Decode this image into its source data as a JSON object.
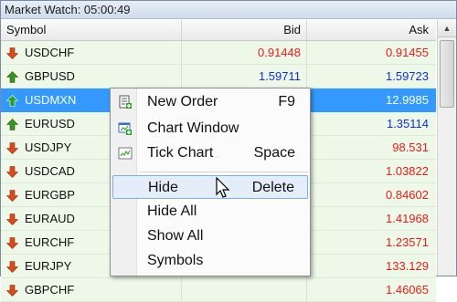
{
  "window": {
    "title": "Market Watch: 05:00:49"
  },
  "columns": {
    "symbol": "Symbol",
    "bid": "Bid",
    "ask": "Ask"
  },
  "colors": {
    "up": "#22a022",
    "down": "#e04a1a",
    "bid_red": "#e81c1c",
    "bid_blue": "#1030d0",
    "selection": "#3399ff"
  },
  "rows": [
    {
      "symbol": "USDCHF",
      "bid": "0.91448",
      "ask": "0.91455",
      "dir": "down",
      "bid_color": "red"
    },
    {
      "symbol": "GBPUSD",
      "bid": "1.59711",
      "ask": "1.59723",
      "dir": "up",
      "bid_color": "blue"
    },
    {
      "symbol": "USDMXN",
      "bid": "",
      "ask": "12.9985",
      "dir": "up",
      "bid_color": "blue",
      "selected": true
    },
    {
      "symbol": "EURUSD",
      "bid": "",
      "ask": "1.35114",
      "dir": "up",
      "bid_color": "blue"
    },
    {
      "symbol": "USDJPY",
      "bid": "",
      "ask": "98.531",
      "dir": "down",
      "bid_color": "red"
    },
    {
      "symbol": "USDCAD",
      "bid": "",
      "ask": "1.03822",
      "dir": "down",
      "bid_color": "red"
    },
    {
      "symbol": "EURGBP",
      "bid": "",
      "ask": "0.84602",
      "dir": "down",
      "bid_color": "red"
    },
    {
      "symbol": "EURAUD",
      "bid": "",
      "ask": "1.41968",
      "dir": "down",
      "bid_color": "red"
    },
    {
      "symbol": "EURCHF",
      "bid": "",
      "ask": "1.23571",
      "dir": "down",
      "bid_color": "red"
    },
    {
      "symbol": "EURJPY",
      "bid": "",
      "ask": "133.129",
      "dir": "down",
      "bid_color": "red"
    },
    {
      "symbol": "GBPCHF",
      "bid": "",
      "ask": "1.46065",
      "dir": "down",
      "bid_color": "red"
    }
  ],
  "context_menu": {
    "items": [
      {
        "label": "New Order",
        "shortcut": "F9",
        "icon": "new-order-icon"
      },
      {
        "label": "Chart Window",
        "shortcut": "",
        "icon": "chart-window-icon"
      },
      {
        "label": "Tick Chart",
        "shortcut": "Space",
        "icon": "tick-chart-icon"
      },
      {
        "label": "Hide",
        "shortcut": "Delete",
        "icon": "",
        "hover": true
      },
      {
        "label": "Hide All",
        "shortcut": "",
        "icon": ""
      },
      {
        "label": "Show All",
        "shortcut": "",
        "icon": ""
      },
      {
        "label": "Symbols",
        "shortcut": "",
        "icon": ""
      }
    ]
  }
}
